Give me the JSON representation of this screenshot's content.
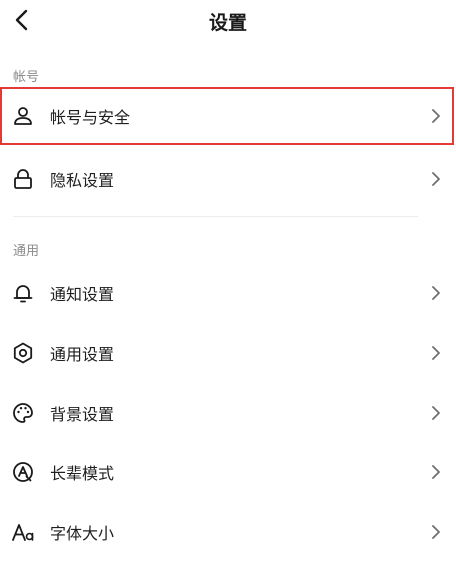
{
  "header": {
    "title": "设置"
  },
  "sections": [
    {
      "label": "帐号",
      "items": [
        {
          "label": "帐号与安全",
          "icon": "user-icon",
          "highlighted": true
        },
        {
          "label": "隐私设置",
          "icon": "lock-icon"
        }
      ]
    },
    {
      "label": "通用",
      "items": [
        {
          "label": "通知设置",
          "icon": "bell-icon"
        },
        {
          "label": "通用设置",
          "icon": "gear-icon"
        },
        {
          "label": "背景设置",
          "icon": "palette-icon"
        },
        {
          "label": "长辈模式",
          "icon": "elder-mode-icon"
        },
        {
          "label": "字体大小",
          "icon": "font-size-icon"
        }
      ]
    }
  ],
  "colors": {
    "highlight": "#e53935",
    "section_label": "#8a8a8a"
  }
}
